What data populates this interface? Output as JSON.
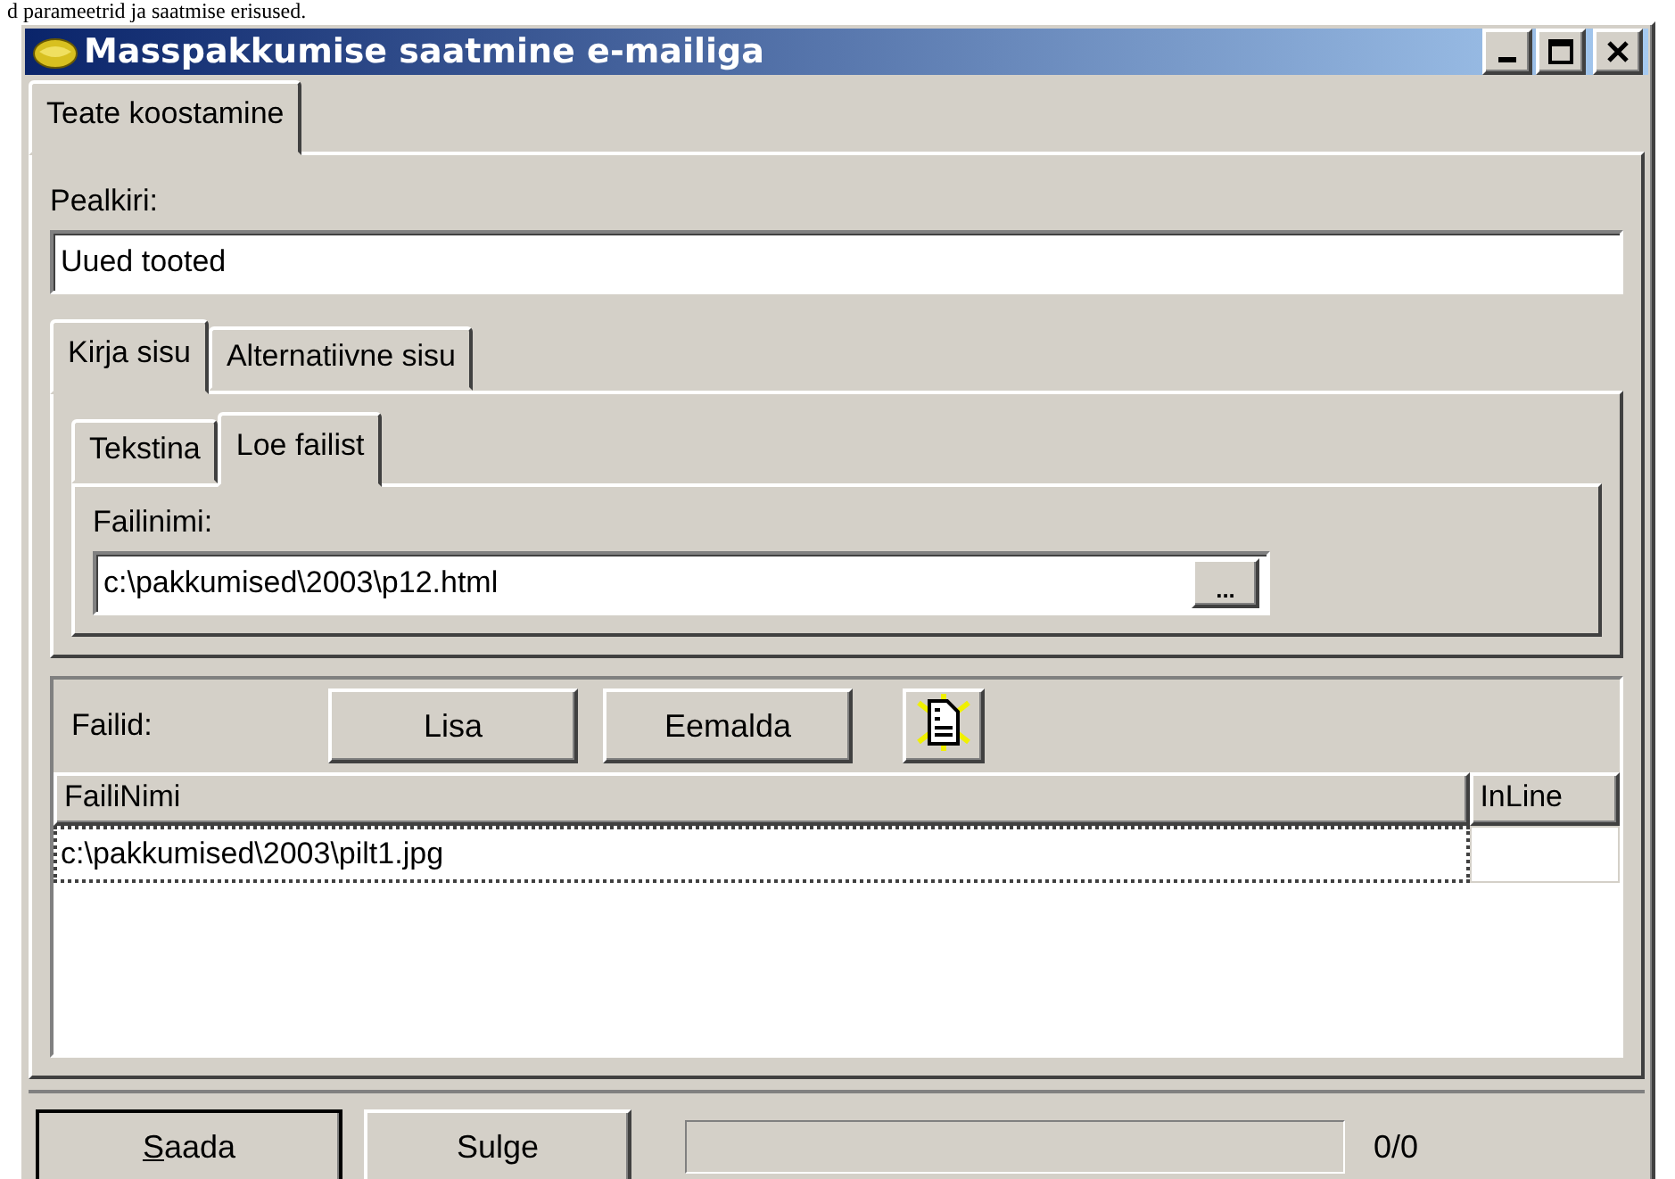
{
  "page_text": "d parameetrid ja saatmise erisused.",
  "window": {
    "title": "Masspakkumise saatmine e-mailiga"
  },
  "main_tabs": [
    {
      "label": "Teate koostamine",
      "selected": true
    }
  ],
  "subject": {
    "label": "Pealkiri:",
    "value": "Uued tooted"
  },
  "content_tabs": [
    {
      "label": "Kirja sisu",
      "selected": true
    },
    {
      "label": "Alternatiivne sisu",
      "selected": false
    }
  ],
  "source_tabs": [
    {
      "label": "Tekstina",
      "selected": false
    },
    {
      "label": "Loe failist",
      "selected": true
    }
  ],
  "file": {
    "label": "Failinimi:",
    "value": "c:\\pakkumised\\2003\\p12.html",
    "browse": "..."
  },
  "attachments": {
    "label": "Failid:",
    "buttons": [
      "Lisa",
      "Eemalda"
    ],
    "columns": [
      "FailiNimi",
      "InLine"
    ],
    "rows": [
      {
        "name": "c:\\pakkumised\\2003\\pilt1.jpg",
        "selected": true
      }
    ]
  },
  "footer": {
    "buttons": [
      {
        "label": "Saada",
        "default": true,
        "mnemonic": true
      },
      {
        "label": "Sulge",
        "default": false,
        "mnemonic": false
      }
    ],
    "progress": {
      "level": 0
    },
    "counter": "0/0"
  }
}
